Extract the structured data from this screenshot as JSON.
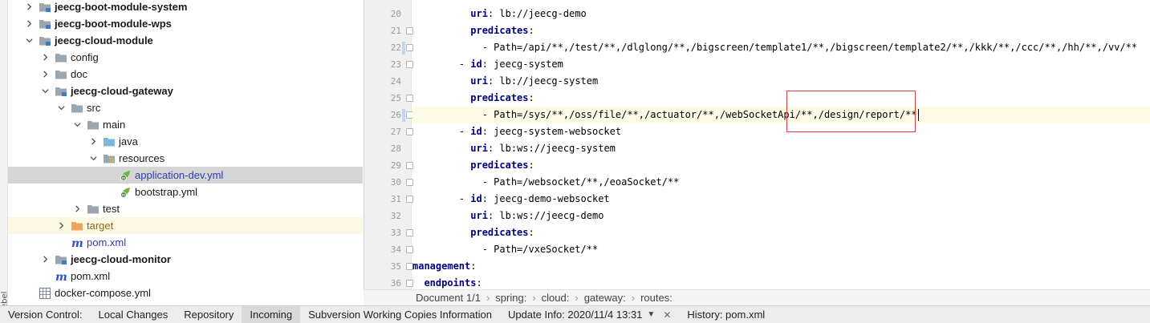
{
  "sidebar_strip": {
    "label": "Rebel"
  },
  "tree": {
    "rows": [
      {
        "label": "jeecg-boot-module-system",
        "icon": "module-folder-icon",
        "arrow": "collapsed",
        "bold": true
      },
      {
        "label": "jeecg-boot-module-wps",
        "icon": "module-folder-icon",
        "arrow": "collapsed",
        "bold": true
      },
      {
        "label": "jeecg-cloud-module",
        "icon": "module-folder-icon",
        "arrow": "expanded",
        "bold": true
      },
      {
        "label": "config",
        "icon": "folder-icon",
        "arrow": "collapsed"
      },
      {
        "label": "doc",
        "icon": "folder-icon",
        "arrow": "collapsed"
      },
      {
        "label": "jeecg-cloud-gateway",
        "icon": "module-folder-icon",
        "arrow": "expanded",
        "bold": true
      },
      {
        "label": "src",
        "icon": "folder-icon",
        "arrow": "expanded"
      },
      {
        "label": "main",
        "icon": "folder-icon",
        "arrow": "expanded"
      },
      {
        "label": "java",
        "icon": "source-folder-icon",
        "arrow": "collapsed"
      },
      {
        "label": "resources",
        "icon": "resources-folder-icon",
        "arrow": "expanded"
      },
      {
        "label": "application-dev.yml",
        "icon": "spring-yaml-icon",
        "arrow": "none",
        "selected": true,
        "blue": true
      },
      {
        "label": "bootstrap.yml",
        "icon": "spring-yaml-icon",
        "arrow": "none"
      },
      {
        "label": "test",
        "icon": "folder-icon",
        "arrow": "collapsed"
      },
      {
        "label": "target",
        "icon": "excluded-folder-icon",
        "arrow": "collapsed",
        "excluded": true
      },
      {
        "label": "pom.xml",
        "icon": "maven-icon",
        "arrow": "none",
        "blue": true
      },
      {
        "label": "jeecg-cloud-monitor",
        "icon": "module-folder-icon",
        "arrow": "collapsed",
        "bold": true
      },
      {
        "label": "pom.xml",
        "icon": "maven-icon",
        "arrow": "none"
      },
      {
        "label": "docker-compose.yml",
        "icon": "grid-file-icon",
        "arrow": "none"
      }
    ]
  },
  "editor": {
    "lines": [
      {
        "num": "20",
        "indent": "          ",
        "key": "uri",
        "value": " lb://jeecg-demo"
      },
      {
        "num": "21",
        "indent": "          ",
        "key": "predicates",
        "value": "",
        "fold": true
      },
      {
        "num": "22",
        "indent": "            ",
        "plain": "- Path=/api/**,/test/**,/dlglong/**,/bigscreen/template1/**,/bigscreen/template2/**,/kkk/**,/ccc/**,/hh/**,/vv/**",
        "fold": true,
        "changed": true
      },
      {
        "num": "23",
        "indent": "        ",
        "dash": "- ",
        "key": "id",
        "value": " jeecg-system",
        "fold": true
      },
      {
        "num": "24",
        "indent": "          ",
        "key": "uri",
        "value": " lb://jeecg-system"
      },
      {
        "num": "25",
        "indent": "          ",
        "key": "predicates",
        "value": "",
        "fold": true
      },
      {
        "num": "26",
        "indent": "            ",
        "plain": "- Path=/sys/**,/oss/file/**,/actuator/**,/webSocketApi/**,/design/report/**",
        "fold": true,
        "changed": true,
        "current": true,
        "caret": true
      },
      {
        "num": "27",
        "indent": "        ",
        "dash": "- ",
        "key": "id",
        "value": " jeecg-system-websocket",
        "fold": true
      },
      {
        "num": "28",
        "indent": "          ",
        "key": "uri",
        "value": " lb:ws://jeecg-system"
      },
      {
        "num": "29",
        "indent": "          ",
        "key": "predicates",
        "value": "",
        "fold": true
      },
      {
        "num": "30",
        "indent": "            ",
        "plain": "- Path=/websocket/**,/eoaSocket/**",
        "fold": true
      },
      {
        "num": "31",
        "indent": "        ",
        "dash": "- ",
        "key": "id",
        "value": " jeecg-demo-websocket",
        "fold": true
      },
      {
        "num": "32",
        "indent": "          ",
        "key": "uri",
        "value": " lb:ws://jeecg-demo"
      },
      {
        "num": "33",
        "indent": "          ",
        "key": "predicates",
        "value": "",
        "fold": true
      },
      {
        "num": "34",
        "indent": "            ",
        "plain": "- Path=/vxeSocket/**",
        "fold": true
      },
      {
        "num": "35",
        "indent": "",
        "key": "management",
        "value": "",
        "fold": true
      },
      {
        "num": "36",
        "indent": "  ",
        "key": "endpoints",
        "value": "",
        "fold": true
      }
    ],
    "breadcrumb": [
      "Document 1/1",
      "spring:",
      "cloud:",
      "gateway:",
      "routes:"
    ]
  },
  "bottom_tabs": [
    {
      "label": "Version Control:"
    },
    {
      "label": "Local Changes"
    },
    {
      "label": "Repository"
    },
    {
      "label": "Incoming",
      "active": true
    },
    {
      "label": "Subversion Working Copies Information"
    },
    {
      "label": "Update Info: 2020/11/4 13:31",
      "dropdown": true,
      "close": true
    },
    {
      "label": "History: pom.xml"
    }
  ],
  "colors": {
    "key": "#000080",
    "selected_row": "#d5d5d5",
    "current_line": "#fdfbe5",
    "highlight_box": "#e04040"
  }
}
